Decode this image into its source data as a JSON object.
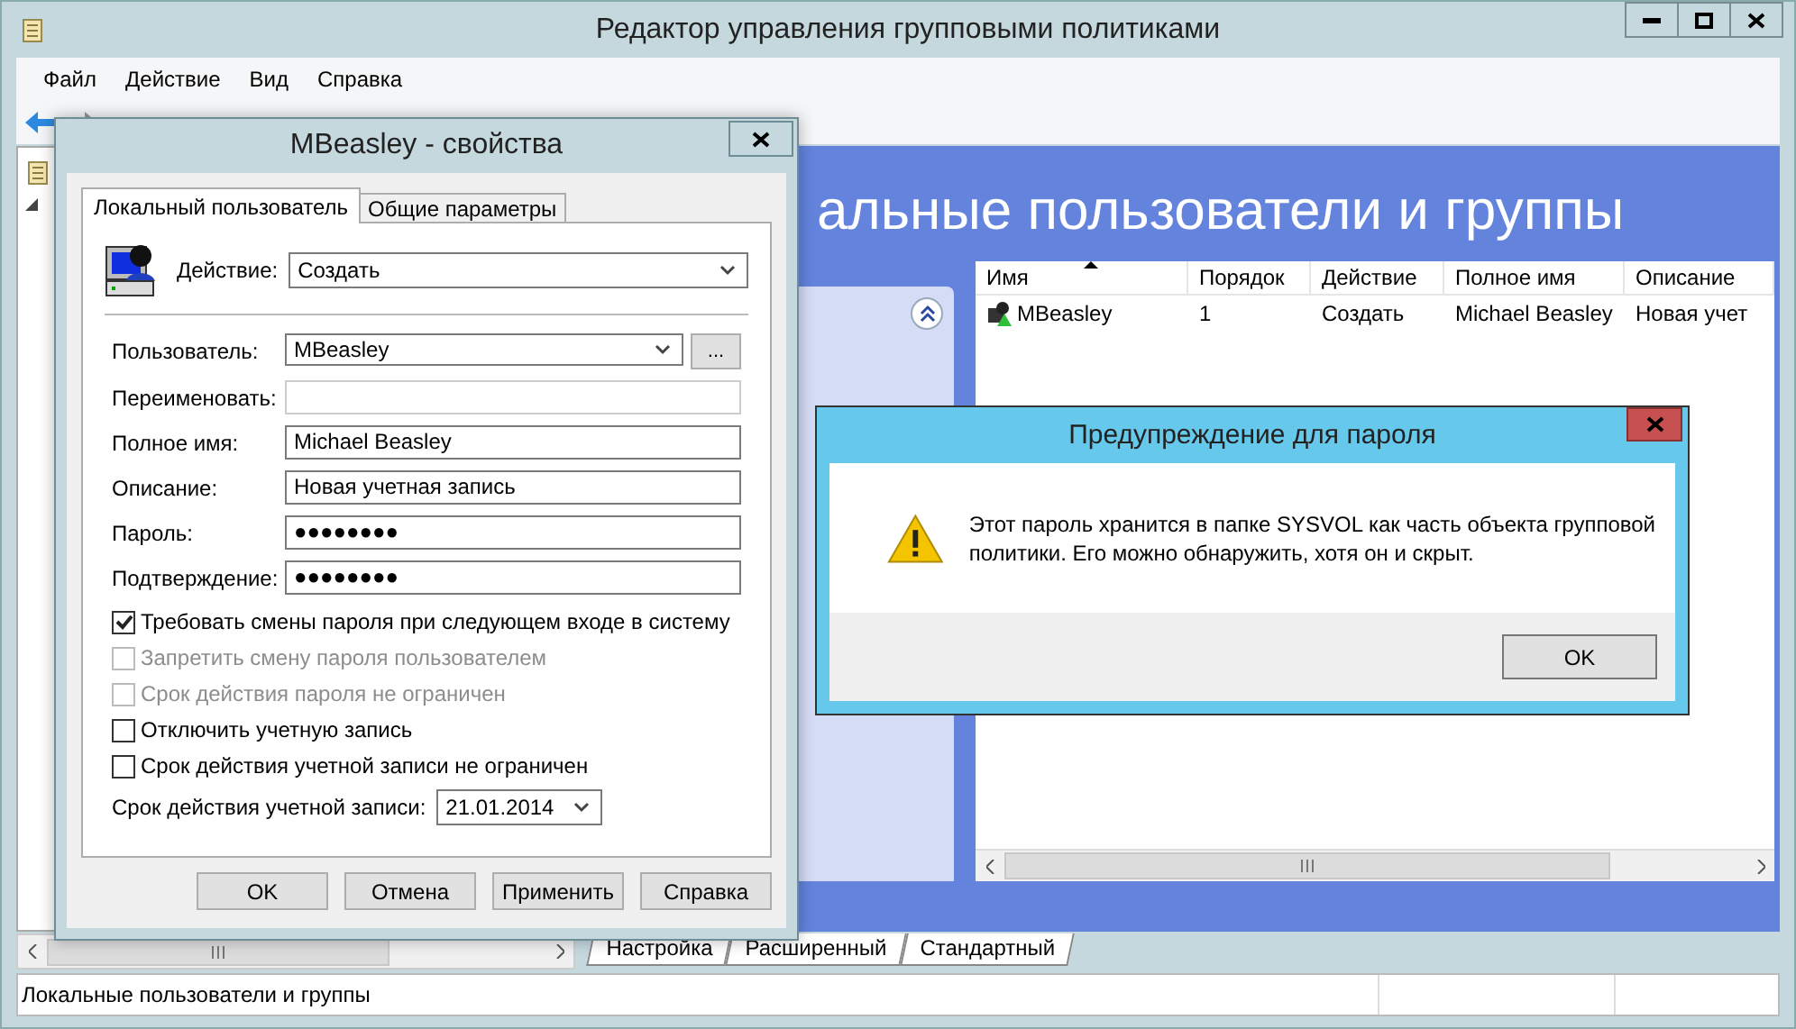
{
  "window": {
    "title": "Редактор управления групповыми политиками"
  },
  "menu": [
    "Файл",
    "Действие",
    "Вид",
    "Справка"
  ],
  "content": {
    "heading": "альные пользователи и группы"
  },
  "list": {
    "columns": [
      {
        "label": "Имя",
        "sorted": true
      },
      {
        "label": "Порядок",
        "sorted": false
      },
      {
        "label": "Действие",
        "sorted": false
      },
      {
        "label": "Полное имя",
        "sorted": false
      },
      {
        "label": "Описание",
        "sorted": false
      }
    ],
    "rows": [
      {
        "cells": [
          "MBeasley",
          "1",
          "Создать",
          "Michael Beasley",
          "Новая учет"
        ]
      }
    ]
  },
  "view_tabs": [
    "Настройка",
    "Расширенный",
    "Стандартный"
  ],
  "status_bar": {
    "text": "Локальные пользователи и группы"
  },
  "properties_dialog": {
    "title": "MBeasley - свойства",
    "tabs": [
      {
        "label": "Локальный пользователь",
        "selected": true
      },
      {
        "label": "Общие параметры",
        "selected": false
      }
    ],
    "action": {
      "label": "Действие:",
      "value": "Создать"
    },
    "fields": [
      {
        "label": "Пользователь:",
        "value": "MBeasley",
        "kind": "combo"
      },
      {
        "label": "Переименовать:",
        "kind": "text",
        "disabled": true
      },
      {
        "label": "Полное имя:",
        "value": "Michael Beasley",
        "kind": "text",
        "disabled": false
      },
      {
        "label": "Описание:",
        "value": "Новая учетная запись",
        "kind": "text",
        "disabled": false
      },
      {
        "label": "Пароль:",
        "value": "●●●●●●●●",
        "kind": "text",
        "disabled": false
      },
      {
        "label": "Подтверждение:",
        "value": "●●●●●●●●",
        "kind": "text",
        "disabled": false
      }
    ],
    "browse_button": "...",
    "options": [
      {
        "label": "Требовать смены пароля при следующем входе в систему",
        "checked": true,
        "disabled": false
      },
      {
        "label": "Запретить смену пароля пользователем",
        "checked": false,
        "disabled": true
      },
      {
        "label": "Срок действия пароля не ограничен",
        "checked": false,
        "disabled": true
      },
      {
        "label": "Отключить учетную запись",
        "checked": false,
        "disabled": false
      },
      {
        "label": "Срок действия учетной записи не ограничен",
        "checked": false,
        "disabled": false
      }
    ],
    "expiry": {
      "label": "Срок действия учетной записи:",
      "value": "21.01.2014"
    },
    "buttons": [
      "OK",
      "Отмена",
      "Применить",
      "Справка"
    ]
  },
  "warning_dialog": {
    "title": "Предупреждение для пароля",
    "message": "Этот пароль хранится в папке SYSVOL как часть объекта групповой политики. Его можно обнаружить, хотя он и скрыт.",
    "buttons": [
      "OK"
    ]
  }
}
